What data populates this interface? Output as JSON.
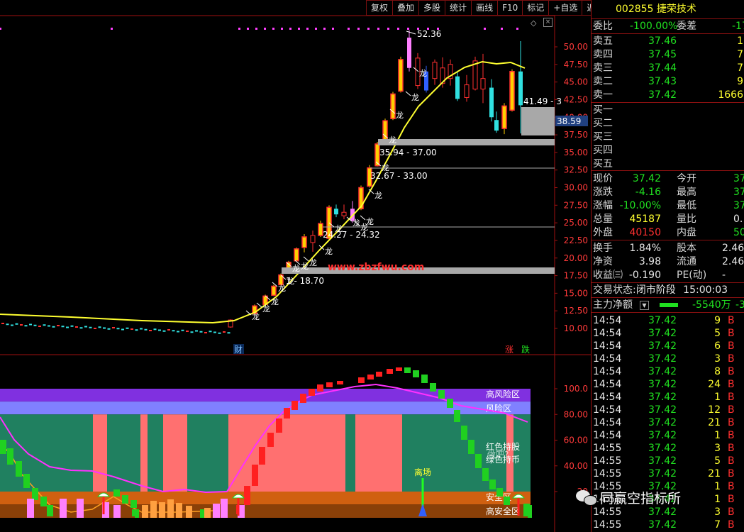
{
  "toolbar": {
    "items": [
      "复权",
      "叠加",
      "多股",
      "统计",
      "画线",
      "F10",
      "标记",
      "+自选",
      "返回"
    ]
  },
  "stock": {
    "code": "002855",
    "name": "捷荣技术"
  },
  "order_book": {
    "wei_bi_label": "委比",
    "wei_bi": "-100.00%",
    "wei_cha_label": "委差",
    "wei_cha": "-17",
    "asks": [
      {
        "label": "卖五",
        "price": "37.46",
        "vol": "1"
      },
      {
        "label": "卖四",
        "price": "37.45",
        "vol": "7"
      },
      {
        "label": "卖三",
        "price": "37.44",
        "vol": "7"
      },
      {
        "label": "卖二",
        "price": "37.43",
        "vol": "9"
      },
      {
        "label": "卖一",
        "price": "37.42",
        "vol": "1666"
      }
    ],
    "bids": [
      {
        "label": "买一"
      },
      {
        "label": "买二"
      },
      {
        "label": "买三"
      },
      {
        "label": "买四"
      },
      {
        "label": "买五"
      }
    ]
  },
  "quote": {
    "rows": [
      {
        "l1": "现价",
        "v1": "37.42",
        "l2": "今开",
        "v2": "37."
      },
      {
        "l1": "涨跌",
        "v1": "-4.16",
        "l2": "最高",
        "v2": "37."
      },
      {
        "l1": "涨幅",
        "v1": "-10.00%",
        "l2": "最低",
        "v2": "37."
      },
      {
        "l1": "总量",
        "v1": "45187",
        "l2": "量比",
        "v2": "0."
      },
      {
        "l1": "外盘",
        "v1": "40150",
        "l2": "内盘",
        "v2": "50"
      }
    ],
    "rows2": [
      {
        "l1": "换手",
        "v1": "1.84%",
        "l2": "股本",
        "v2": "2.46"
      },
      {
        "l1": "净资",
        "v1": "3.98",
        "l2": "流通",
        "v2": "2.46"
      },
      {
        "l1": "收益㈢",
        "v1": "-0.190",
        "l2": "PE(动)",
        "v2": "-"
      }
    ],
    "status_label": "交易状态:",
    "status": "闭市阶段",
    "status_time": "15:00:03",
    "main_flow_label": "主力净额",
    "main_flow": "-5540万",
    "main_flow2": "-3"
  },
  "ticks": [
    {
      "t": "14:54",
      "p": "37.42",
      "v": "9",
      "s": "B"
    },
    {
      "t": "14:54",
      "p": "37.42",
      "v": "5",
      "s": "B"
    },
    {
      "t": "14:54",
      "p": "37.42",
      "v": "6",
      "s": "B"
    },
    {
      "t": "14:54",
      "p": "37.42",
      "v": "3",
      "s": "B"
    },
    {
      "t": "14:54",
      "p": "37.42",
      "v": "8",
      "s": "B"
    },
    {
      "t": "14:54",
      "p": "37.42",
      "v": "24",
      "s": "B"
    },
    {
      "t": "14:54",
      "p": "37.42",
      "v": "1",
      "s": "B"
    },
    {
      "t": "14:54",
      "p": "37.42",
      "v": "12",
      "s": "B"
    },
    {
      "t": "14:54",
      "p": "37.42",
      "v": "21",
      "s": "B"
    },
    {
      "t": "14:54",
      "p": "37.42",
      "v": "1",
      "s": "B"
    },
    {
      "t": "14:55",
      "p": "37.42",
      "v": "3",
      "s": "B"
    },
    {
      "t": "14:55",
      "p": "37.42",
      "v": "5",
      "s": "B"
    },
    {
      "t": "14:55",
      "p": "37.42",
      "v": "21",
      "s": "B"
    },
    {
      "t": "14:55",
      "p": "37.42",
      "v": "1",
      "s": "B"
    },
    {
      "t": "14:55",
      "p": "37.42",
      "v": "1",
      "s": "B"
    },
    {
      "t": "14:55",
      "p": "37.42",
      "v": "3",
      "s": "B"
    },
    {
      "t": "14:55",
      "p": "37.42",
      "v": "7",
      "s": "B"
    }
  ],
  "main_chart": {
    "y_ticks": [
      "50.00",
      "47.50",
      "45.00",
      "42.50",
      "40.00",
      "37.50",
      "35.00",
      "32.50",
      "30.00",
      "27.50",
      "25.00",
      "22.50",
      "20.00",
      "17.50",
      "15.00",
      "12.50",
      "10.00"
    ],
    "current_price_tag": "38.59",
    "high_label": "52.36",
    "range_labels": [
      "41.49 - 3",
      "35.94 - 37.00",
      "32.67 - 33.00",
      "24.27 - 24.32",
      "1 - 18.70"
    ],
    "dragon_char": "龙",
    "watermark": "www.zbzfwu.com",
    "event_cai": "财",
    "event_zhang": "涨",
    "event_die": "跌"
  },
  "indicator": {
    "y_ticks": [
      "100.0",
      "80.00",
      "60.00",
      "40.00",
      "20"
    ],
    "zone_labels": [
      "高风险区",
      "风险区",
      "红色持股",
      "绿色持币",
      "安全区",
      "高安全区"
    ],
    "overlap_label": "做吧?",
    "exit_label": "离场"
  },
  "watermark_account": "同赢空指标所",
  "colors": {
    "up": "#ff3030",
    "down": "#30e0e0",
    "ma": "#ffff30",
    "accent": "#a01010"
  }
}
